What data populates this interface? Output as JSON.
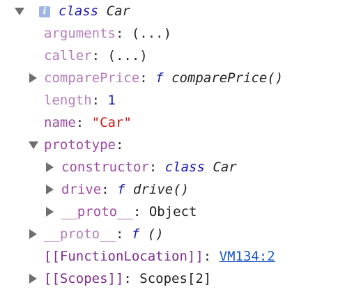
{
  "root": {
    "info_icon_glyph": "i",
    "keyword": "class",
    "name": "Car"
  },
  "props": {
    "arguments": {
      "key": "arguments",
      "value": "(...)"
    },
    "caller": {
      "key": "caller",
      "value": "(...)"
    },
    "comparePrice": {
      "key": "comparePrice",
      "fn": "f",
      "value": "comparePrice()"
    },
    "length": {
      "key": "length",
      "value": "1"
    },
    "name": {
      "key": "name",
      "value": "\"Car\""
    },
    "prototype": {
      "key": "prototype",
      "constructor": {
        "key": "constructor",
        "keyword": "class",
        "value": "Car"
      },
      "drive": {
        "key": "drive",
        "fn": "f",
        "value": "drive()"
      },
      "proto": {
        "key": "__proto__",
        "value": "Object"
      }
    },
    "proto": {
      "key": "__proto__",
      "fn": "f",
      "value": "()"
    },
    "function_location": {
      "key": "[[FunctionLocation]]",
      "value": "VM134:2"
    },
    "scopes": {
      "key": "[[Scopes]]",
      "value": "Scopes[2]"
    }
  },
  "colors": {
    "property_key": "#9c4ba0",
    "function_marker": "#1a1aa6",
    "number": "#1a1aa6",
    "string": "#c41a16",
    "link": "#1a56c4",
    "info_icon_bg": "#9fb7e3"
  },
  "icons": {
    "expanded": "triangle-down",
    "collapsed": "triangle-right",
    "info": "info-badge"
  }
}
